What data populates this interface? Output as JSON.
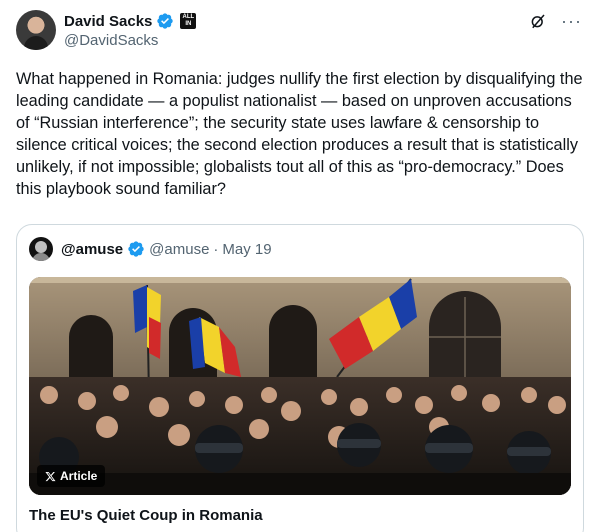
{
  "author": {
    "display_name": "David Sacks",
    "handle": "@DavidSacks",
    "affiliation_badge": "ALL IN",
    "verified": true
  },
  "tweet": {
    "text": "What happened in Romania: judges nullify the first election by disqualifying the leading candidate — a populist nationalist — based on unproven accusations of “Russian interference”; the security state uses lawfare & censorship to silence critical voices; the second election produces a result that is statistically unlikely, if not impossible; globalists tout all of this as “pro-democracy.” Does this playbook sound familiar?"
  },
  "quote": {
    "display_name": "@amuse",
    "handle": "@amuse",
    "separator": "·",
    "date": "May 19",
    "verified": true,
    "media_badge": "Article",
    "title": "The EU's Quiet Coup in Romania"
  },
  "icons": {
    "verified": "verified-badge-icon",
    "grok": "grok-icon",
    "more": "more-icon",
    "x_logo": "x-logo-icon"
  },
  "colors": {
    "verified": "#1d9bf0",
    "secondary_text": "#536471",
    "border": "#cfd9de"
  }
}
